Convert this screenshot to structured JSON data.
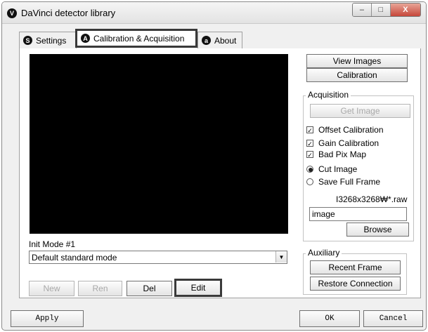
{
  "window": {
    "title": "DaVinci detector library",
    "icon_letter": "V",
    "caption_buttons": {
      "minimize": "–",
      "maximize": "□",
      "close": "X"
    }
  },
  "tabs": [
    {
      "label": "Settings",
      "icon_letter": "S",
      "selected": false
    },
    {
      "label": "Calibration & Acquisition",
      "icon_letter": "A",
      "selected": true
    },
    {
      "label": "About",
      "icon_letter": "a",
      "selected": false
    }
  ],
  "right_buttons": {
    "view_images": "View Images",
    "calibration": "Calibration"
  },
  "acquisition": {
    "label": "Acquisition",
    "get_image": "Get Image",
    "offset_calibration": {
      "label": "Offset Calibration",
      "checked": true
    },
    "gain_calibration": {
      "label": "Gain Calibration",
      "checked": true
    },
    "bad_pix_map": {
      "label": "Bad Pix Map",
      "checked": true
    },
    "cut_image": {
      "label": "Cut Image",
      "selected": true
    },
    "save_full_frame": {
      "label": "Save Full Frame",
      "selected": false
    },
    "file_suffix": "I3268x3268₩*.raw",
    "filename_value": "image",
    "browse": "Browse"
  },
  "init_mode": {
    "label": "Init Mode #1",
    "selected": "Default standard mode",
    "arrow": "▼"
  },
  "mode_buttons": {
    "new": "New",
    "ren": "Ren",
    "del": "Del",
    "edit": "Edit"
  },
  "auxiliary": {
    "label": "Auxiliary",
    "recent_frame": "Recent Frame",
    "restore_connection": "Restore Connection"
  },
  "footer": {
    "apply": "Apply",
    "ok": "OK",
    "cancel": "Cancel"
  },
  "colors": {
    "emphasis_border": "#3a3a3a",
    "disabled_text": "#a8a8a8"
  }
}
